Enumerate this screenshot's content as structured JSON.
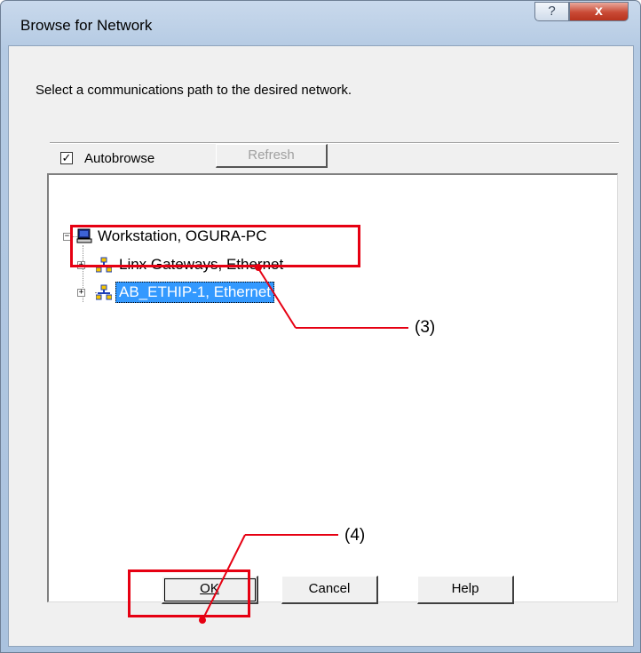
{
  "window": {
    "title": "Browse for Network",
    "help_button": "?",
    "close_button": "x"
  },
  "prompt": "Select a communications path to the desired network.",
  "autobrowse": {
    "label": "Autobrowse",
    "checked": true,
    "mark": "✓"
  },
  "refresh_label": "Refresh",
  "tree": {
    "root": {
      "label": "Workstation, OGURA-PC",
      "expander": "−"
    },
    "children": [
      {
        "label": "Linx Gateways, Ethernet",
        "expander": "+"
      },
      {
        "label": "AB_ETHIP-1, Ethernet",
        "expander": "+",
        "selected": true
      }
    ]
  },
  "buttons": {
    "ok": "OK",
    "cancel": "Cancel",
    "help": "Help"
  },
  "annotations": {
    "tree_selection": "(3)",
    "ok_button": "(4)",
    "color": "#e60012"
  }
}
